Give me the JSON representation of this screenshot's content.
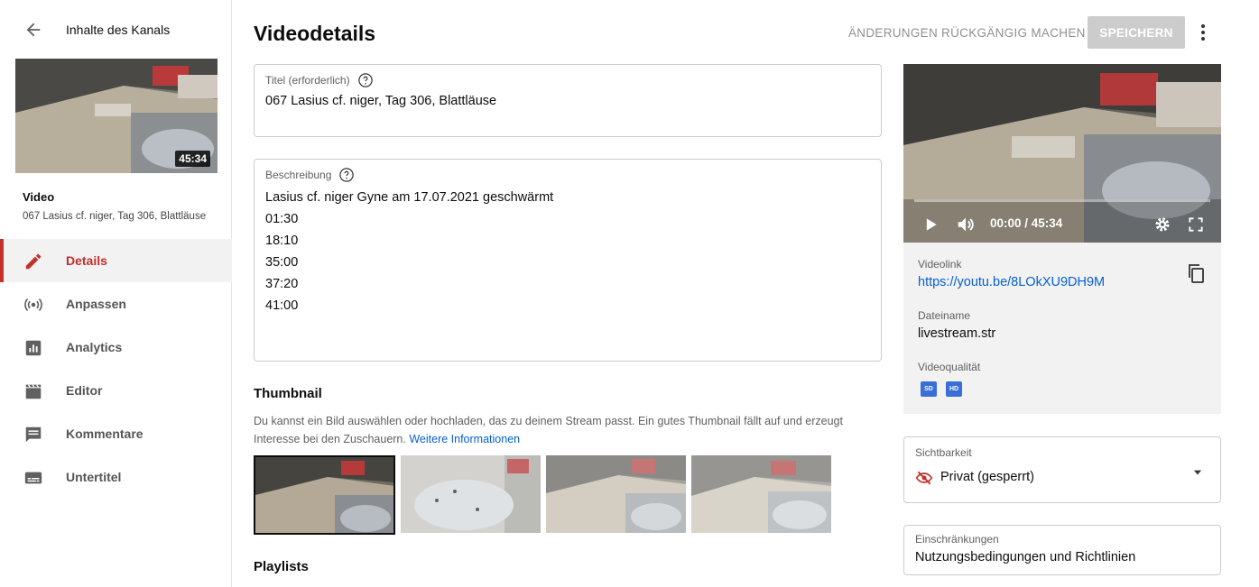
{
  "sidebar": {
    "back_label": "Inhalte des Kanals",
    "thumb_duration": "45:34",
    "video_label": "Video",
    "video_title": "067 Lasius cf. niger, Tag 306, Blattläuse",
    "items": [
      {
        "label": "Details",
        "icon": "pencil-icon",
        "active": true
      },
      {
        "label": "Anpassen",
        "icon": "broadcast-icon"
      },
      {
        "label": "Analytics",
        "icon": "bar-chart-icon"
      },
      {
        "label": "Editor",
        "icon": "clapperboard-icon"
      },
      {
        "label": "Kommentare",
        "icon": "comment-icon"
      },
      {
        "label": "Untertitel",
        "icon": "subtitles-icon"
      }
    ]
  },
  "header": {
    "title": "Videodetails",
    "undo_label": "ÄNDERUNGEN RÜCKGÄNGIG MACHEN",
    "save_label": "SPEICHERN"
  },
  "form": {
    "title_label": "Titel (erforderlich)",
    "title_value": "067 Lasius cf. niger, Tag 306, Blattläuse",
    "description_label": "Beschreibung",
    "description_lines": [
      "Lasius cf. niger Gyne am 17.07.2021 geschwärmt",
      "01:30",
      "18:10",
      "35:00",
      "37:20",
      "41:00"
    ]
  },
  "thumbnail": {
    "heading": "Thumbnail",
    "description": "Du kannst ein Bild auswählen oder hochladen, das zu deinem Stream passt. Ein gutes Thumbnail fällt auf und erzeugt Interesse bei den Zuschauern.",
    "link": "Weitere Informationen"
  },
  "playlists": {
    "heading": "Playlists"
  },
  "preview": {
    "time": "00:00 / 45:34",
    "video_link_label": "Videolink",
    "video_link": "https://youtu.be/8LOkXU9DH9M",
    "filename_label": "Dateiname",
    "filename": "livestream.str",
    "quality_label": "Videoqualität",
    "quality_badges": [
      "SD",
      "HD"
    ]
  },
  "visibility": {
    "label": "Sichtbarkeit",
    "value": "Privat (gesperrt)",
    "icon": "eye-off-icon"
  },
  "restrictions": {
    "label": "Einschränkungen",
    "value": "Nutzungsbedingungen und Richtlinien"
  },
  "colors": {
    "accent_red": "#c4302b",
    "link_blue": "#065fd4",
    "badge_blue": "#3a6fd8"
  }
}
